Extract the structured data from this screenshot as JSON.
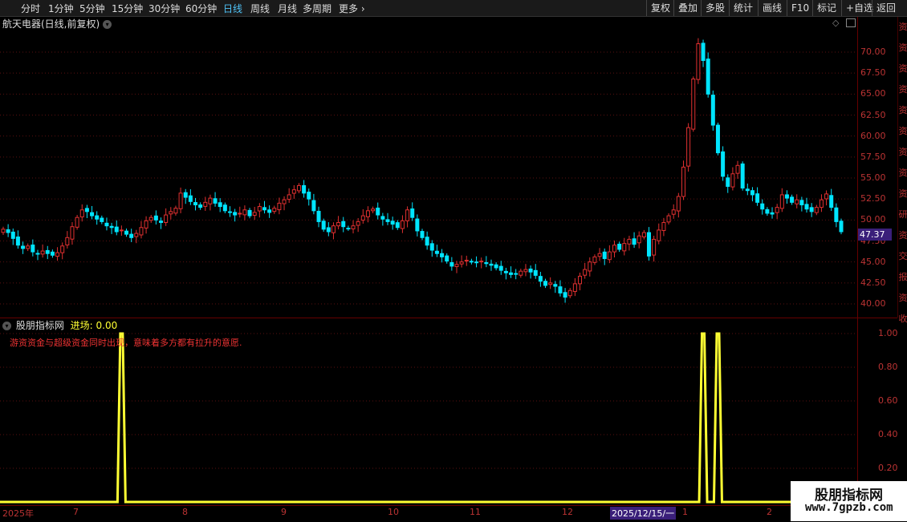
{
  "toolbar": {
    "periods": [
      "分时",
      "1分钟",
      "5分钟",
      "15分钟",
      "30分钟",
      "60分钟",
      "日线",
      "周线",
      "月线",
      "多周期",
      "更多"
    ],
    "active": "日线",
    "actions": [
      "复权",
      "叠加",
      "多股",
      "统计",
      "画线",
      "F10",
      "标记",
      "+自选",
      "返回"
    ]
  },
  "symbol": {
    "title": "航天电器(日线,前复权)"
  },
  "price_axis": [
    "70.00",
    "67.50",
    "65.00",
    "62.50",
    "60.00",
    "57.50",
    "55.00",
    "52.50",
    "50.00",
    "47.50",
    "45.00",
    "42.50",
    "40.00"
  ],
  "last_price": "47.37",
  "right_strip": [
    "资",
    "资",
    "资",
    "资",
    "资",
    "资",
    "资",
    "资",
    "资",
    "研",
    "资",
    "交",
    "报",
    "资",
    "收"
  ],
  "indicator": {
    "name": "股朋指标网",
    "value_label": "进场: 0.00",
    "description": "游资资金与超级资金同时出现，意味着多方都有拉升的意愿.",
    "axis": [
      "1.00",
      "0.80",
      "0.60",
      "0.40",
      "0.20"
    ]
  },
  "dates": {
    "labels": [
      "2025年",
      "7",
      "8",
      "9",
      "10",
      "11",
      "12",
      "1",
      "2"
    ],
    "cursor": "2025/12/15/一"
  },
  "watermark": {
    "name": "股朋指标网",
    "url": "www.7gpzb.com"
  },
  "colors": {
    "up": "#e03030",
    "down": "#00e5ff",
    "signal": "#ffff33",
    "accent": "#4fc3f7"
  },
  "chart_data": {
    "type": "candlestick",
    "ylim": [
      39,
      73
    ],
    "closes": [
      48.9,
      48.5,
      47.8,
      47.0,
      46.6,
      46.9,
      46.2,
      46.0,
      46.3,
      46.0,
      45.8,
      46.1,
      46.9,
      47.9,
      49.2,
      50.3,
      51.2,
      51.0,
      50.5,
      50.1,
      49.8,
      49.3,
      49.1,
      48.6,
      48.8,
      48.3,
      47.9,
      48.4,
      49.1,
      49.9,
      50.3,
      50.0,
      49.7,
      50.6,
      51.0,
      51.4,
      53.2,
      52.7,
      52.2,
      51.8,
      51.5,
      52.1,
      52.6,
      52.0,
      51.6,
      51.1,
      50.9,
      50.6,
      50.8,
      51.2,
      50.5,
      50.9,
      51.6,
      51.2,
      50.9,
      51.4,
      52.0,
      52.4,
      53.0,
      53.6,
      54.1,
      53.2,
      52.5,
      51.1,
      49.8,
      48.9,
      48.6,
      49.3,
      49.7,
      49.2,
      49.0,
      49.3,
      49.8,
      50.5,
      51.1,
      51.3,
      50.6,
      50.1,
      49.8,
      49.5,
      49.1,
      49.9,
      51.2,
      50.3,
      48.7,
      47.9,
      47.0,
      46.4,
      46.0,
      45.6,
      45.1,
      44.5,
      44.7,
      45.0,
      45.2,
      45.0,
      44.9,
      45.1,
      44.8,
      44.6,
      44.3,
      44.0,
      43.7,
      43.5,
      43.6,
      43.9,
      44.1,
      43.8,
      43.4,
      42.7,
      42.2,
      42.5,
      42.1,
      41.3,
      40.8,
      41.6,
      42.4,
      43.3,
      44.1,
      45.0,
      45.6,
      46.0,
      45.4,
      46.2,
      47.0,
      46.5,
      47.2,
      47.7,
      47.1,
      48.1,
      48.5,
      45.7,
      47.7,
      48.8,
      49.7,
      50.5,
      51.2,
      52.8,
      56.3,
      61.0,
      66.8,
      71.0,
      69.0,
      65.0,
      61.3,
      58.0,
      55.2,
      54.0,
      55.5,
      56.5,
      53.8,
      53.5,
      53.0,
      52.1,
      51.3,
      50.8,
      50.7,
      51.5,
      53.0,
      52.6,
      52.1,
      52.4,
      51.8,
      51.3,
      51.0,
      51.5,
      52.4,
      53.1,
      51.5,
      49.8,
      48.6
    ],
    "signal_peaks_index": [
      24,
      142,
      145
    ]
  }
}
